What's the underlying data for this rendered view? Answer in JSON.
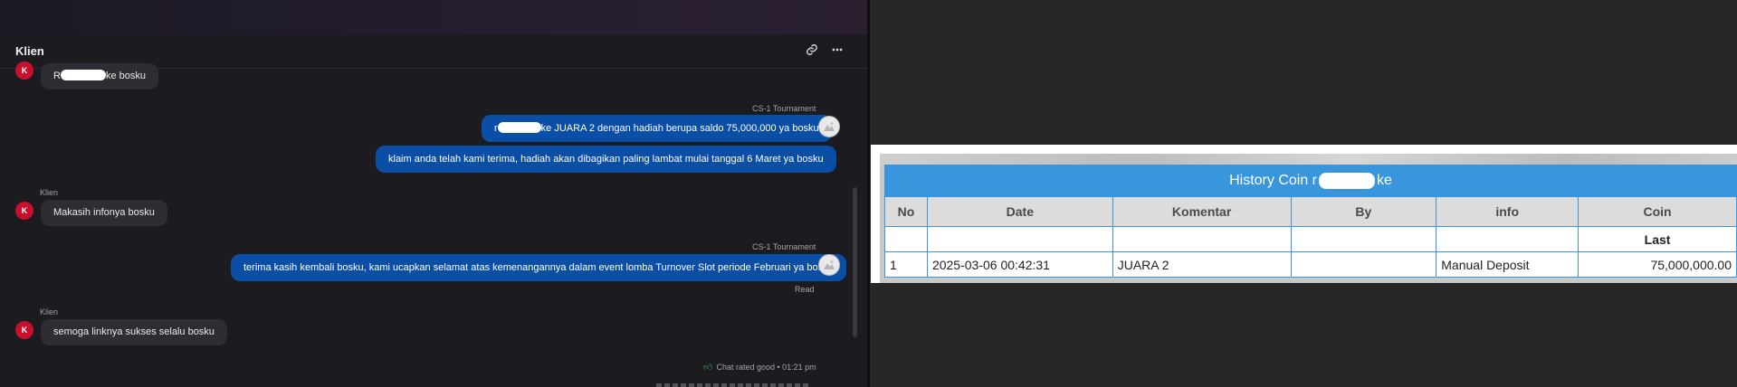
{
  "chat": {
    "title": "Klien",
    "messages": [
      {
        "sender": "",
        "avatar_letter": "K",
        "prefix": "R",
        "suffix": "ke bosku"
      },
      {
        "sender": "CS-1 Tournament",
        "prefix": "r",
        "suffix": "ke JUARA 2 dengan hadiah berupa saldo 75,000,000 ya bosku"
      },
      {
        "text": "klaim anda telah kami terima, hadiah akan dibagikan paling lambat mulai tanggal 6 Maret ya bosku"
      },
      {
        "sender": "Klien",
        "avatar_letter": "K",
        "text": "Makasih infonya bosku"
      },
      {
        "sender": "CS-1 Tournament",
        "text": "terima kasih kembali bosku, kami ucapkan selamat atas kemenangannya dalam event lomba Turnover Slot periode Februari ya bosku",
        "status": "Read"
      },
      {
        "sender": "Klien",
        "avatar_letter": "K",
        "text": "semoga linknya sukses selalu bosku"
      }
    ],
    "rating": {
      "text": "Chat rated good",
      "time": "01:21 pm"
    }
  },
  "history": {
    "title_prefix": "History Coin r",
    "title_suffix": "ke",
    "columns": [
      "No",
      "Date",
      "Komentar",
      "By",
      "info",
      "Coin"
    ],
    "subheader": "Last",
    "rows": [
      {
        "no": "1",
        "date": "2025-03-06 00:42:31",
        "komentar": "JUARA 2",
        "by": "",
        "info": "Manual Deposit",
        "coin": "75,000,000.00"
      }
    ]
  },
  "colors": {
    "outgoing_bubble": "#0b4ea6",
    "incoming_bubble": "#2e2d33",
    "avatar": "#c8102e",
    "table_accent": "#3a96dc",
    "coin_value": "#1a8a1a"
  }
}
